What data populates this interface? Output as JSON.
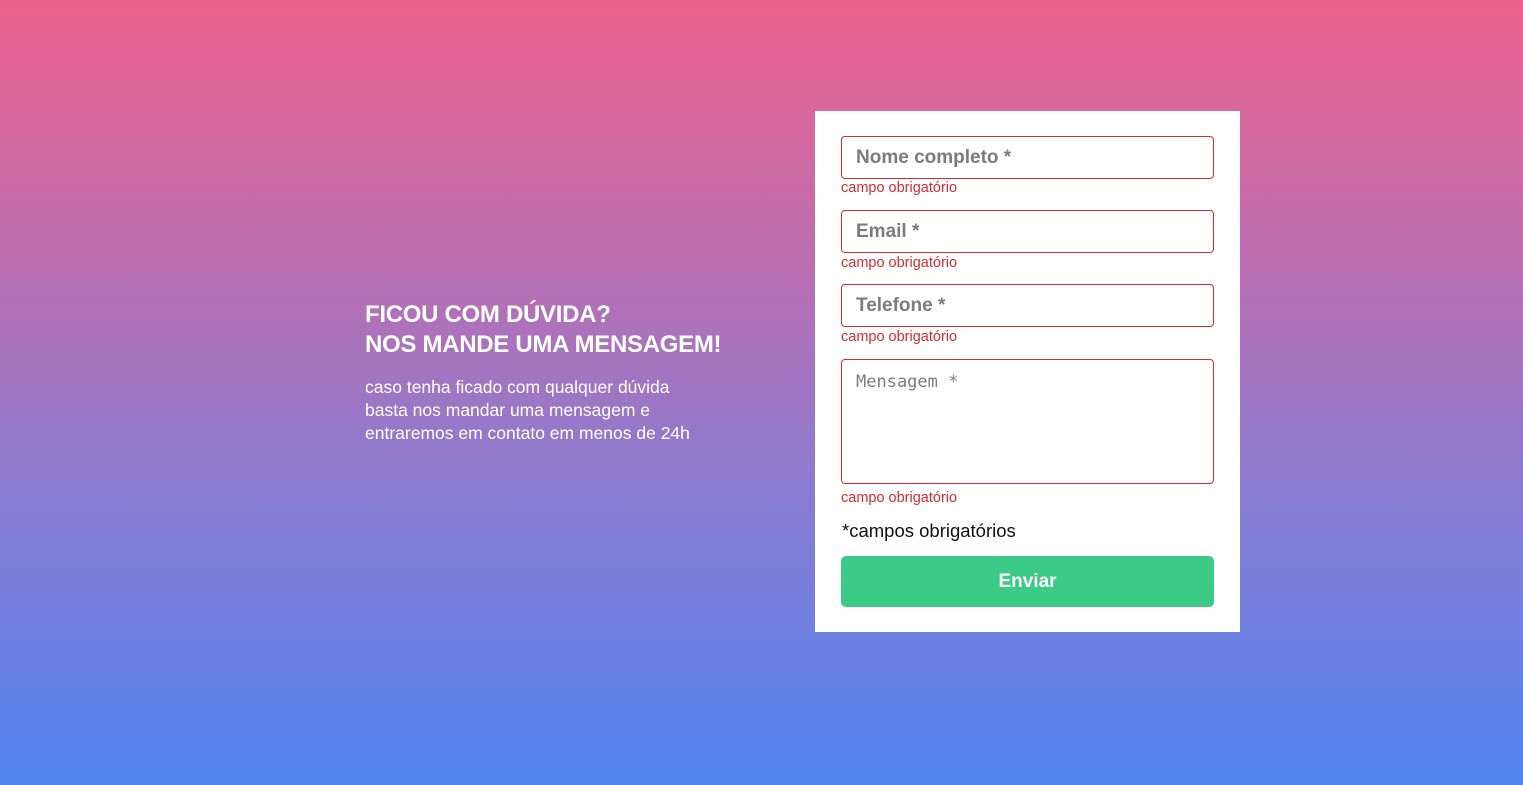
{
  "intro": {
    "heading_line1": "FICOU COM DÚVIDA?",
    "heading_line2": "NOS MANDE UMA MENSAGEM!",
    "description": "caso tenha ficado com qualquer dúvida basta nos mandar uma mensagem e entraremos em contato em menos de 24h"
  },
  "form": {
    "name": {
      "placeholder": "Nome completo *",
      "value": "",
      "error": "campo obrigatório"
    },
    "email": {
      "placeholder": "Email *",
      "value": "",
      "error": "campo obrigatório"
    },
    "phone": {
      "placeholder": "Telefone *",
      "value": "",
      "error": "campo obrigatório"
    },
    "message": {
      "placeholder": "Mensagem *",
      "value": "",
      "error": "campo obrigatório"
    },
    "required_note": "*campos obrigatórios",
    "submit_label": "Enviar"
  },
  "colors": {
    "gradient_top": "#ec618c",
    "gradient_bottom": "#5285f0",
    "error": "#d92b2b",
    "submit": "#3ccb87"
  }
}
